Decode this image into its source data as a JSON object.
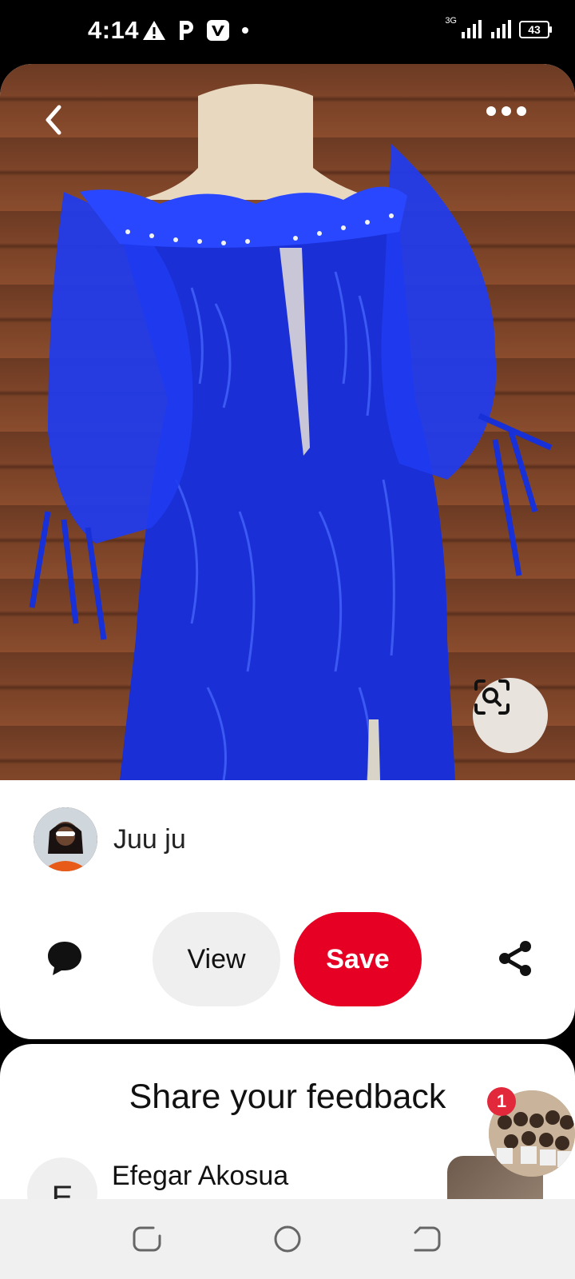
{
  "status_bar": {
    "time": "4:14",
    "battery": "43",
    "network": "3G"
  },
  "pin": {
    "creator_name": "Juu ju",
    "actions": {
      "view_label": "View",
      "save_label": "Save"
    }
  },
  "feedback": {
    "title": "Share your feedback",
    "commenter_initial": "E",
    "commenter_name": "Efegar Akosua"
  },
  "chat_bubble": {
    "badge_count": "1"
  },
  "colors": {
    "save_red": "#e60023",
    "view_gray": "#efefef",
    "badge_red": "#e2293b"
  }
}
